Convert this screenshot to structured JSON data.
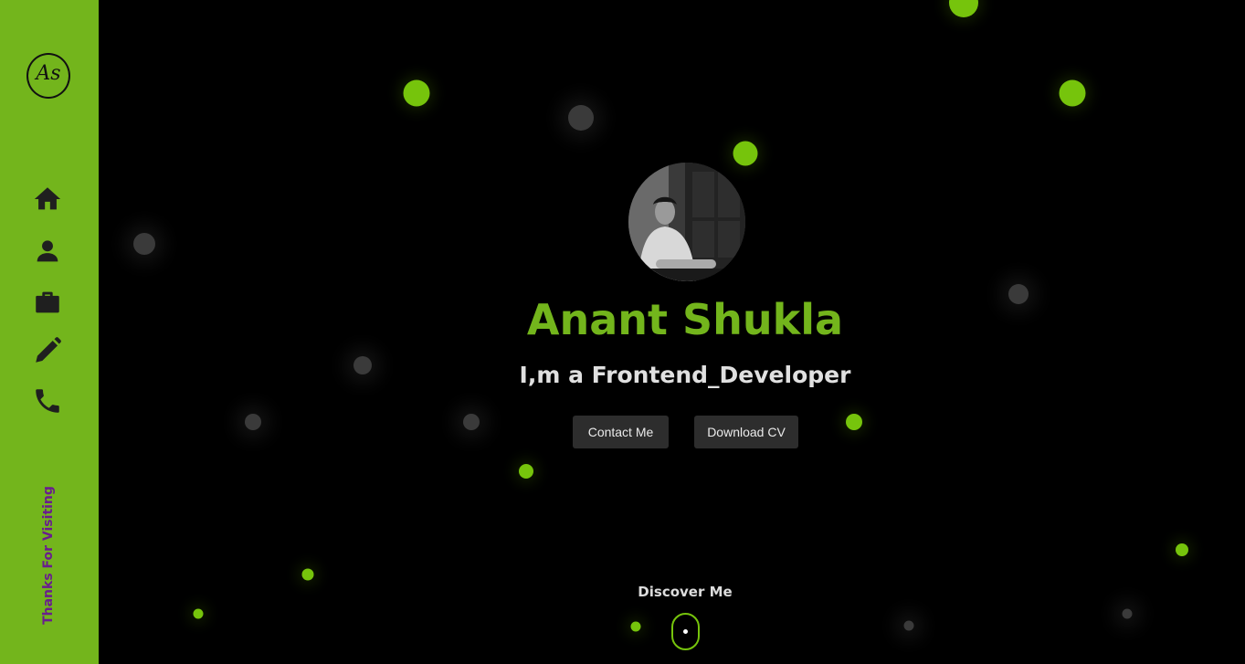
{
  "brand": {
    "logo_text": "As"
  },
  "sidebar": {
    "icons": [
      "home-icon",
      "user-icon",
      "briefcase-icon",
      "pencil-icon",
      "phone-icon"
    ],
    "footer_text": "Thanks For Visiting"
  },
  "hero": {
    "name": "Anant Shukla",
    "tagline": "I,m a Frontend_Developer",
    "contact_label": "Contact Me",
    "cv_label": "Download CV",
    "discover_label": "Discover Me"
  },
  "colors": {
    "accent": "#73b51c",
    "dot_green": "#76c40c",
    "dot_gray": "#3a3a3a",
    "background": "#000000",
    "button_bg": "#2d2d2d",
    "footer_text": "#6a1d8e"
  }
}
